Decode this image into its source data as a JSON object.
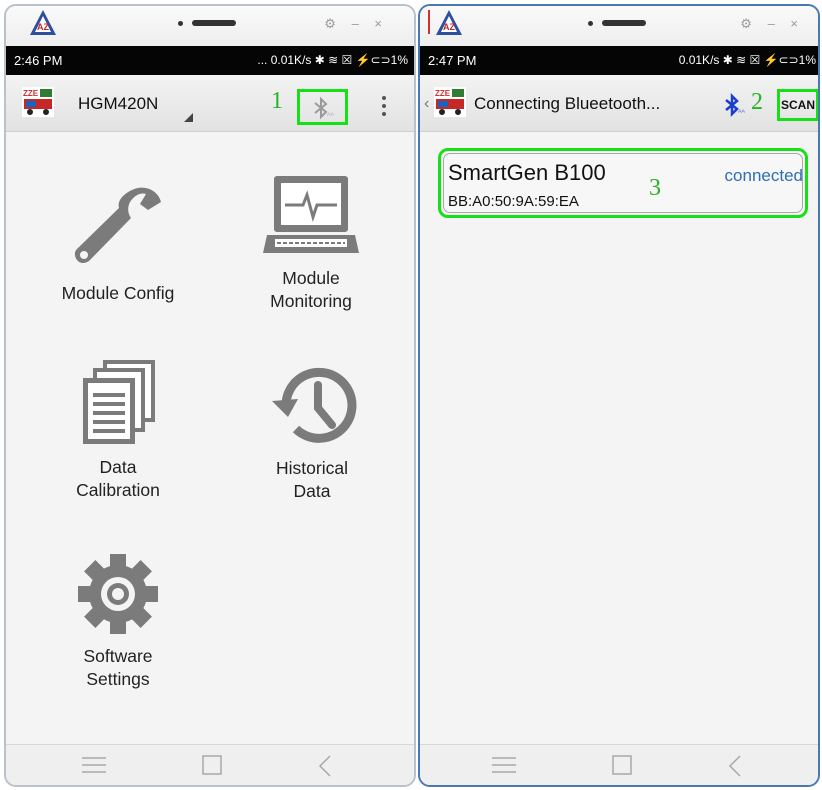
{
  "left_screen": {
    "status_bar": {
      "time": "2:46 PM",
      "info": "... 0.01K/s ✱ ≋ ☒ ⚡⊂⊃1%"
    },
    "app_bar": {
      "title": "HGM420N"
    },
    "annotation": "1",
    "menu": [
      {
        "label": "Module Config",
        "icon": "wrench-icon"
      },
      {
        "label": "Module\nMonitoring",
        "icon": "monitor-icon"
      },
      {
        "label": "Data\nCalibration",
        "icon": "documents-icon"
      },
      {
        "label": "Historical\nData",
        "icon": "history-icon"
      },
      {
        "label": "Software\nSettings",
        "icon": "gear-icon"
      }
    ]
  },
  "right_screen": {
    "status_bar": {
      "time": "2:47 PM",
      "info": "0.01K/s ✱ ≋ ☒ ⚡⊂⊃1%"
    },
    "app_bar": {
      "title": "Connecting Blueetooth...",
      "scan_label": "SCAN"
    },
    "annotation_scan": "2",
    "annotation_device": "3",
    "device": {
      "name": "SmartGen B100",
      "mac": "BB:A0:50:9A:59:EA",
      "status": "connected"
    }
  },
  "colors": {
    "highlight_green": "#16e016",
    "annotation_green": "#22b422",
    "bluetooth_blue": "#1a3fd0",
    "connected_blue": "#2f6db7"
  }
}
